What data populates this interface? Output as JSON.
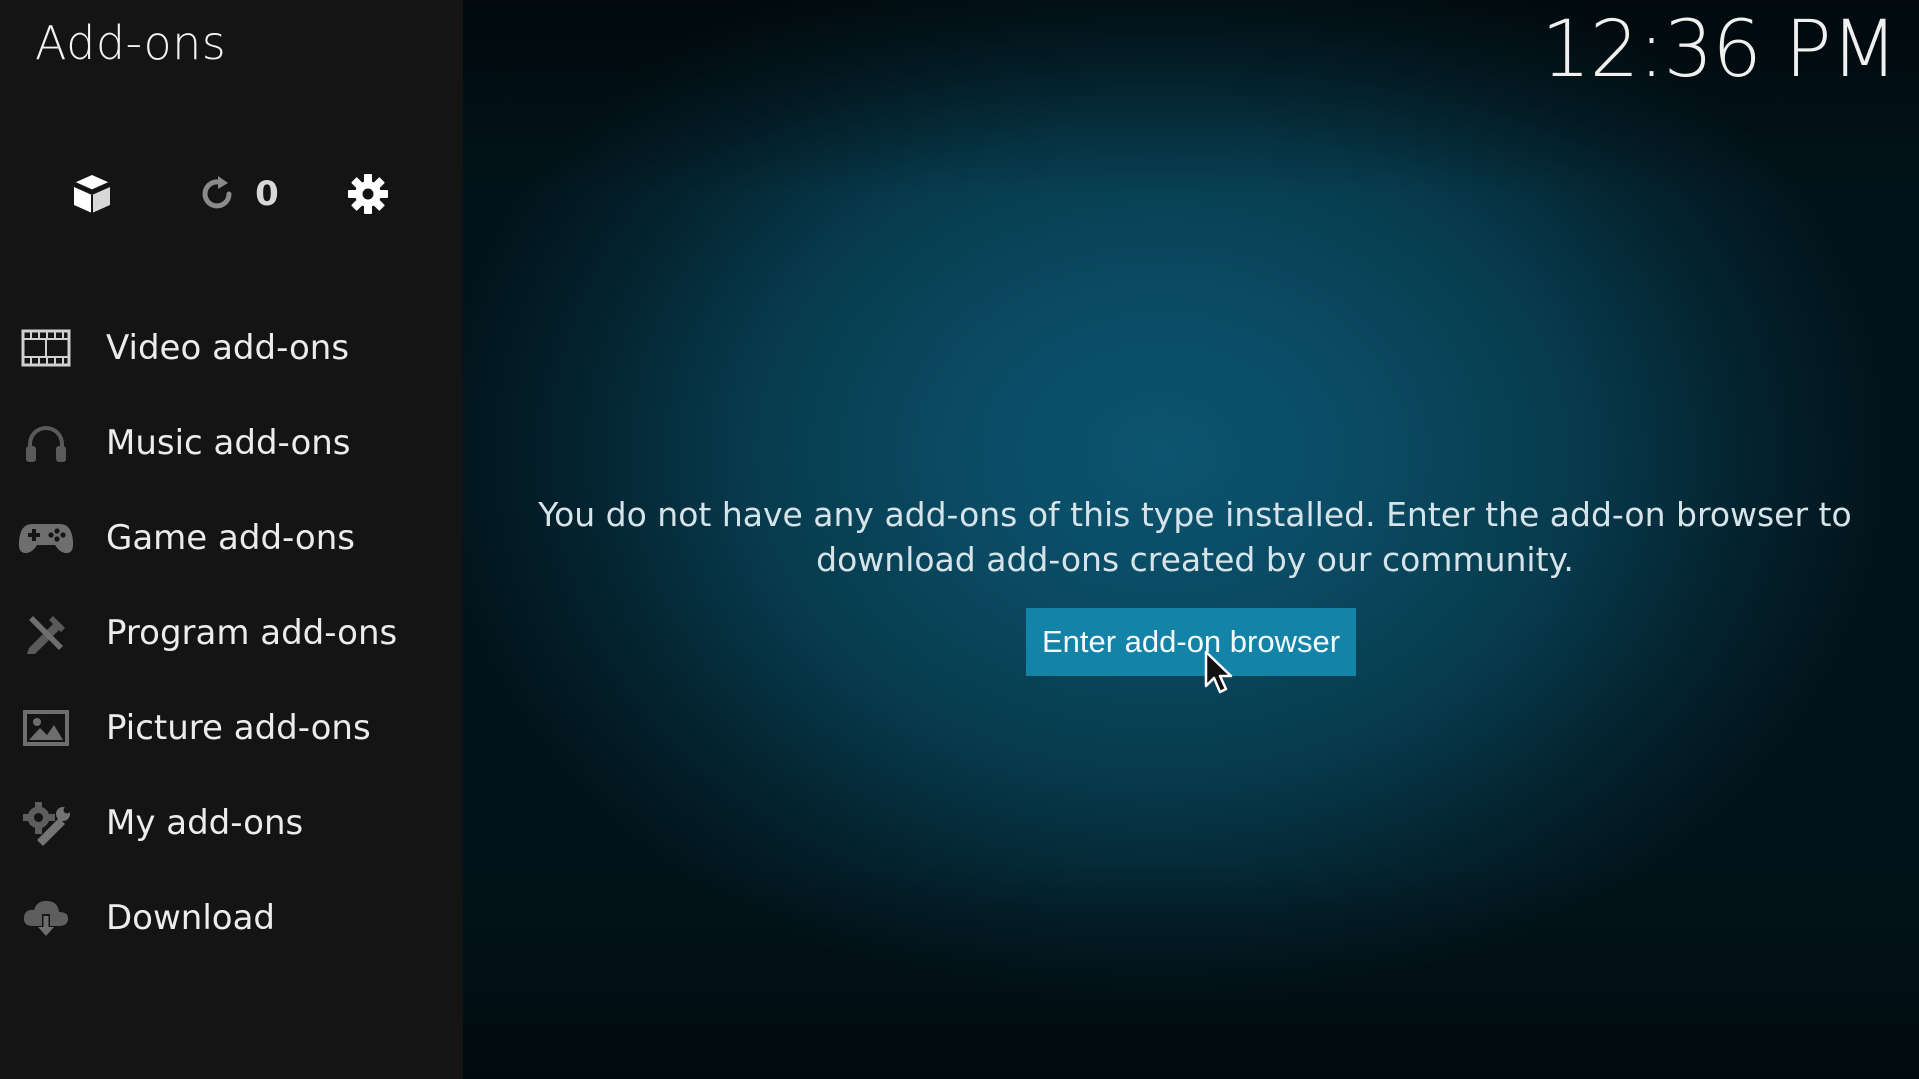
{
  "header": {
    "title": "Add-ons",
    "clock": "12:36 PM"
  },
  "toolbar": {
    "addon_icon": "open-box-icon",
    "updates_icon": "refresh-icon",
    "updates_count": "0",
    "settings_icon": "gear-icon"
  },
  "sidebar": {
    "items": [
      {
        "label": "Video add-ons",
        "icon": "film-strip-icon"
      },
      {
        "label": "Music add-ons",
        "icon": "headphones-icon"
      },
      {
        "label": "Game add-ons",
        "icon": "gamepad-icon"
      },
      {
        "label": "Program add-ons",
        "icon": "tools-icon"
      },
      {
        "label": "Picture add-ons",
        "icon": "picture-icon"
      },
      {
        "label": "My add-ons",
        "icon": "gear-wrench-icon"
      },
      {
        "label": "Download",
        "icon": "cloud-download-icon"
      }
    ]
  },
  "main": {
    "message": "You do not have any add-ons of this type installed. Enter the add-on browser to download add-ons created by our community.",
    "button_label": "Enter add-on browser"
  },
  "colors": {
    "accent": "#1483a8",
    "sidebar_bg": "#141414",
    "main_glow": "#0c5470"
  }
}
